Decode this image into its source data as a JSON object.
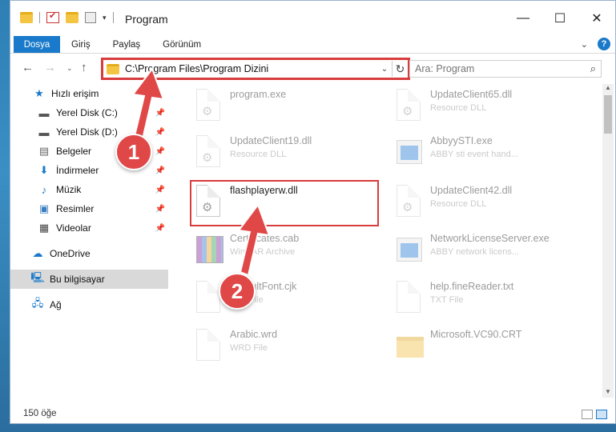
{
  "window": {
    "title": "Program",
    "controls": {
      "minimize": "—",
      "maximize": "☐",
      "close": "✕"
    }
  },
  "ribbon": {
    "tabs": [
      "Dosya",
      "Giriş",
      "Paylaş",
      "Görünüm"
    ],
    "expand_icon": "chevron-down-icon",
    "help_label": "?"
  },
  "address": {
    "path": "C:\\Program Files\\Program Dizini",
    "search_placeholder": "Ara: Program"
  },
  "sidebar": {
    "items": [
      {
        "label": "Hızlı erişim",
        "icon": "star-icon",
        "pinned": false
      },
      {
        "label": "Yerel Disk (C:)",
        "icon": "drive-icon",
        "pinned": true
      },
      {
        "label": "Yerel Disk (D:)",
        "icon": "drive-icon",
        "pinned": true
      },
      {
        "label": "Belgeler",
        "icon": "document-icon",
        "pinned": true
      },
      {
        "label": "İndirmeler",
        "icon": "download-icon",
        "pinned": true
      },
      {
        "label": "Müzik",
        "icon": "music-icon",
        "pinned": true
      },
      {
        "label": "Resimler",
        "icon": "picture-icon",
        "pinned": true
      },
      {
        "label": "Videolar",
        "icon": "video-icon",
        "pinned": true
      },
      {
        "label": "OneDrive",
        "icon": "cloud-icon",
        "pinned": false
      },
      {
        "label": "Bu bilgisayar",
        "icon": "computer-icon",
        "pinned": false
      },
      {
        "label": "Ağ",
        "icon": "network-icon",
        "pinned": false
      }
    ]
  },
  "files": [
    {
      "name": "program.exe",
      "type": "",
      "kind": "exe"
    },
    {
      "name": "UpdateClient65.dll",
      "type": "Resource DLL",
      "kind": "dll"
    },
    {
      "name": "UpdateClient19.dll",
      "type": "Resource DLL",
      "kind": "dll"
    },
    {
      "name": "AbbyySTI.exe",
      "type": "ABBY sti event hand...",
      "kind": "app"
    },
    {
      "name": "flashplayerw.dll",
      "type": "",
      "kind": "dll"
    },
    {
      "name": "UpdateClient42.dll",
      "type": "Resource DLL",
      "kind": "dll"
    },
    {
      "name": "Certificates.cab",
      "type": "WinRAR Archive",
      "kind": "rar"
    },
    {
      "name": "NetworkLicenseServer.exe",
      "type": "ABBY network licens...",
      "kind": "app"
    },
    {
      "name": "DefaultFont.cjk",
      "type": "CJK File",
      "kind": "blank"
    },
    {
      "name": "help.fineReader.txt",
      "type": "TXT File",
      "kind": "blank"
    },
    {
      "name": "Arabic.wrd",
      "type": "WRD File",
      "kind": "blank"
    },
    {
      "name": "Microsoft.VC90.CRT",
      "type": "",
      "kind": "folder"
    }
  ],
  "status": {
    "item_count": "150 öğe"
  },
  "callouts": [
    "1",
    "2"
  ],
  "colors": {
    "accent": "#1979ca",
    "highlight": "#d93c3c",
    "callout": "#e04848"
  }
}
